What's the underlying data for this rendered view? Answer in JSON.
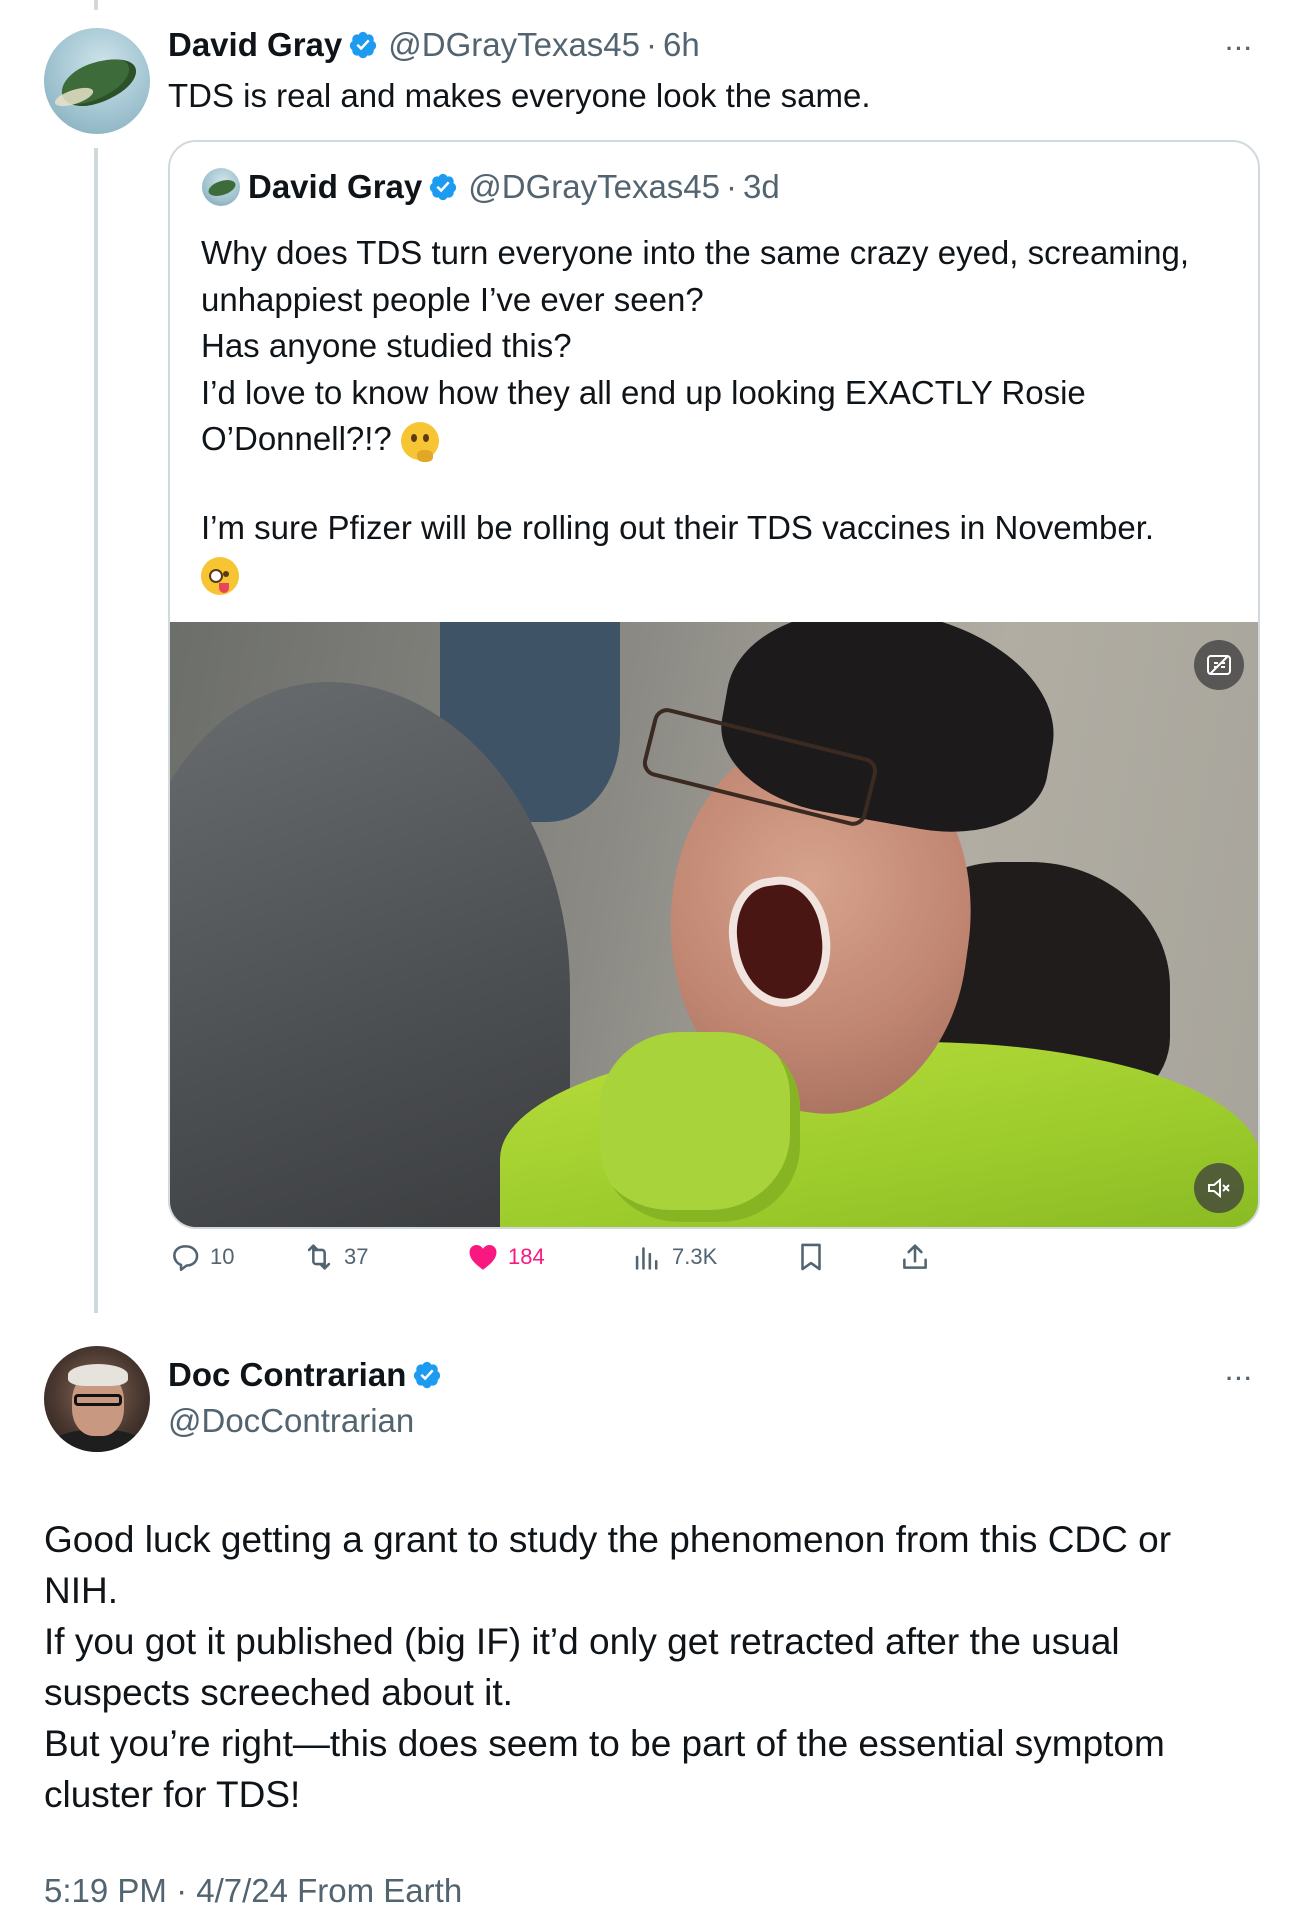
{
  "parent_tweet": {
    "author_name": "David Gray",
    "handle": "@DGrayTexas45",
    "separator": "·",
    "time": "6h",
    "more": "···",
    "text": "TDS is real and makes everyone look the same.",
    "quoted": {
      "author_name": "David Gray",
      "handle": "@DGrayTexas45",
      "separator": "·",
      "time": "3d",
      "lines": [
        "Why does TDS turn everyone into the same crazy eyed, screaming,",
        "unhappiest people I’ve ever seen?",
        "Has anyone studied this?",
        "I’d love to know how they all end up looking EXACTLY Rosie",
        "O’Donnell?!?"
      ],
      "line2": "I’m sure Pfizer will be rolling out their TDS vaccines in November.",
      "emoji_1": "thinking-face",
      "emoji_2": "zany-face"
    },
    "actions": {
      "replies": "10",
      "reposts": "37",
      "likes": "184",
      "views": "7.3K"
    }
  },
  "reply_tweet": {
    "author_name": "Doc Contrarian",
    "handle": "@DocContrarian",
    "more": "···",
    "lines": [
      "Good luck getting a grant to study the phenomenon from this CDC or",
      "NIH.",
      "If you got it published (big IF) it’d only get retracted after the usual",
      "suspects screeched about it.",
      "But you’re right—this does seem to be part of the essential symptom",
      "cluster for TDS!"
    ],
    "footer": "5:19 PM · 4/7/24 From Earth"
  },
  "colors": {
    "verified": "#1d9bf0",
    "like": "#f91880",
    "secondary_text": "#536471",
    "border": "#cfd9de"
  }
}
